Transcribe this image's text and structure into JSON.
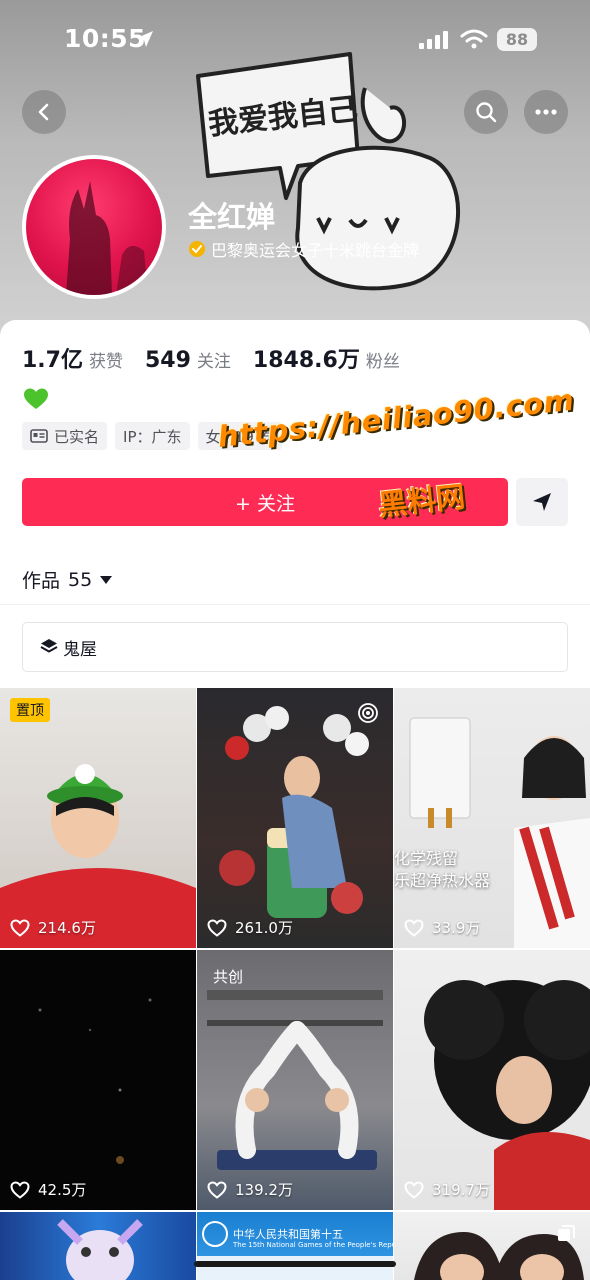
{
  "status_bar": {
    "time": "10:55",
    "battery": "88"
  },
  "banner": {
    "doodle_text": "我爱我自己"
  },
  "profile": {
    "nickname": "全红婵",
    "verification": "巴黎奥运会女子十米跳台金牌",
    "stats": [
      {
        "value": "1.7亿",
        "label": "获赞"
      },
      {
        "value": "549",
        "label": "关注"
      },
      {
        "value": "1848.6万",
        "label": "粉丝"
      }
    ],
    "tags": [
      "已实名",
      "IP：广东",
      "女 · 19 岁"
    ],
    "follow_label": "+ 关注"
  },
  "watermark": {
    "url": "https://heiliao90.com",
    "name": "黑料网"
  },
  "works": {
    "label": "作品",
    "count": "55"
  },
  "collection": {
    "label": "鬼屋"
  },
  "videos": [
    {
      "likes": "214.6万",
      "badge": "置顶"
    },
    {
      "likes": "261.0万"
    },
    {
      "likes": "33.9万",
      "caption_line1": "化学残留",
      "caption_line2": "乐超净热水器"
    },
    {
      "likes": "42.5万"
    },
    {
      "likes": "139.2万",
      "badge": "共创"
    },
    {
      "likes": "319.7万"
    },
    {
      "banner_line1": "中华人民共和国第十五",
      "banner_line2": "The 15th National Games of the People's Republic o"
    }
  ],
  "colors": {
    "accent": "#fe2c55",
    "pin": "#ffc300",
    "verify": "#f5b400"
  }
}
